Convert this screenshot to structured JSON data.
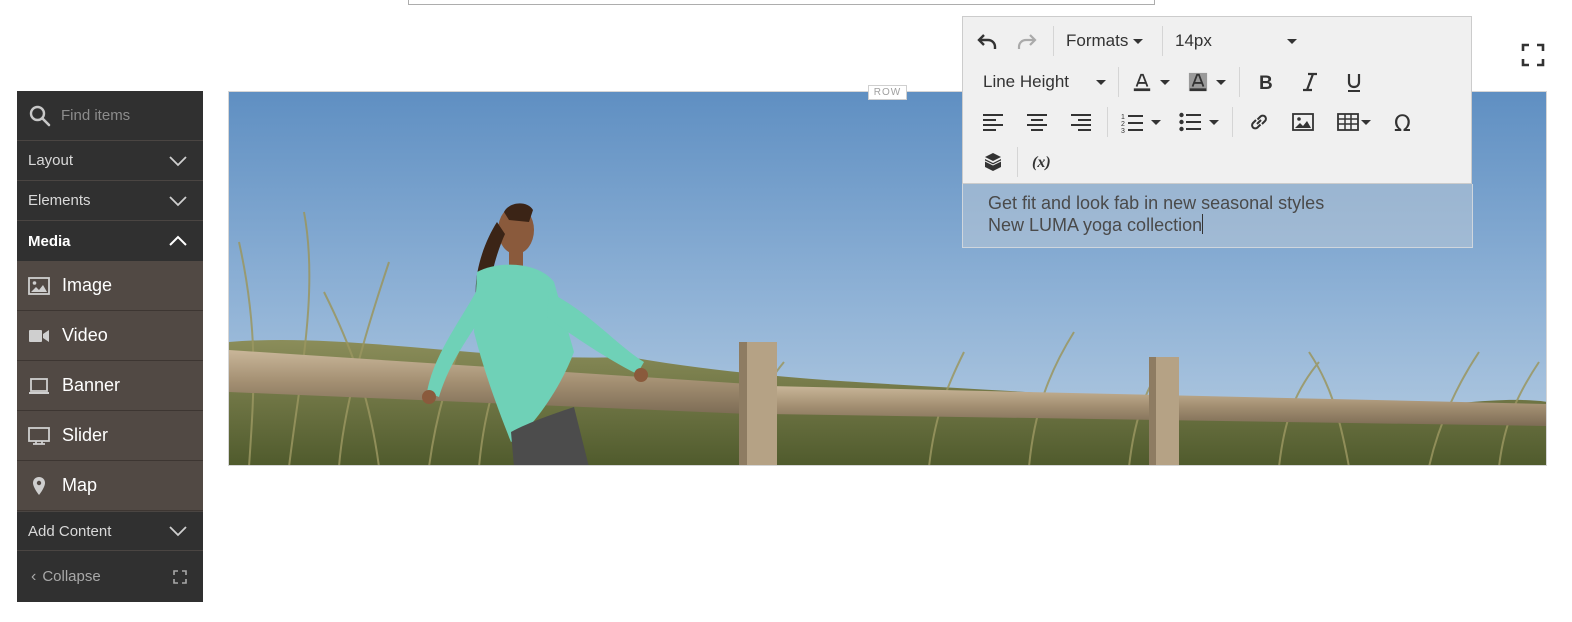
{
  "sidebar": {
    "search_placeholder": "Find items",
    "sections": [
      {
        "label": "Layout"
      },
      {
        "label": "Elements"
      },
      {
        "label": "Media"
      },
      {
        "label": "Add Content"
      }
    ],
    "media_items": [
      {
        "label": "Image",
        "icon": "image-icon"
      },
      {
        "label": "Video",
        "icon": "video-icon"
      },
      {
        "label": "Banner",
        "icon": "banner-icon"
      },
      {
        "label": "Slider",
        "icon": "slider-icon"
      },
      {
        "label": "Map",
        "icon": "map-pin-icon"
      }
    ],
    "collapse_label": "Collapse"
  },
  "stage": {
    "row_label": "ROW"
  },
  "editor": {
    "formats_label": "Formats",
    "font_size": "14px",
    "line_height_label": "Line Height",
    "content_lines": [
      "Get fit and look fab in new seasonal styles",
      "New LUMA yoga collection"
    ]
  },
  "colors": {
    "sidebar_bg": "#303030",
    "media_bg": "#514944",
    "toolbar_bg": "#f0f0f0"
  }
}
